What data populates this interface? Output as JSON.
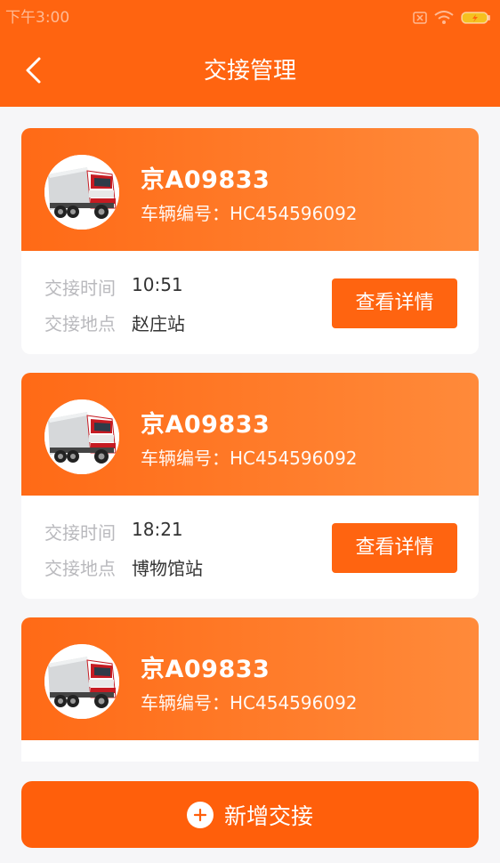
{
  "status_bar": {
    "time": "下午3:00"
  },
  "header": {
    "title": "交接管理"
  },
  "labels": {
    "time_label": "交接时间",
    "location_label": "交接地点",
    "detail_button": "查看详情"
  },
  "cards": [
    {
      "plate": "京A09833",
      "vehicle_no": "车辆编号：HC454596092",
      "time": "10:51",
      "location": "赵庄站"
    },
    {
      "plate": "京A09833",
      "vehicle_no": "车辆编号：HC454596092",
      "time": "18:21",
      "location": "博物馆站"
    },
    {
      "plate": "京A09833",
      "vehicle_no": "车辆编号：HC454596092",
      "time": "",
      "location": ""
    }
  ],
  "footer": {
    "add_button": "新增交接"
  },
  "colors": {
    "primary": "#ff6410",
    "card_gradient_end": "#ff8a3a",
    "label_gray": "#b9b9bd"
  },
  "icons": [
    "back-arrow-icon",
    "sim-icon",
    "wifi-icon",
    "battery-icon",
    "truck-icon",
    "plus-circle-icon"
  ]
}
